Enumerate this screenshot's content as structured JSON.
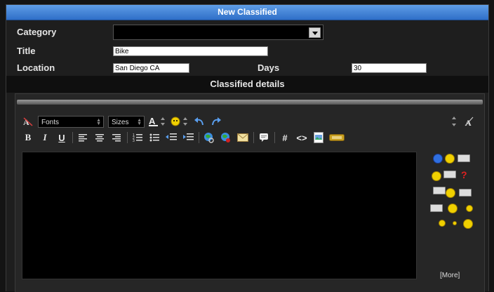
{
  "panel": {
    "title": "New Classified"
  },
  "form": {
    "category_label": "Category",
    "category_value": "",
    "title_label": "Title",
    "title_value": "Bike",
    "location_label": "Location",
    "location_value": "San Diego CA",
    "days_label": "Days",
    "days_value": "30"
  },
  "details": {
    "heading": "Classified details"
  },
  "editor": {
    "fonts_label": "Fonts",
    "sizes_label": "Sizes",
    "more_label": "[More]",
    "toolbar_row1": [
      "remove-format-icon",
      "font-color-icon",
      "smiley-icon",
      "undo-icon",
      "redo-icon",
      "resize-icon",
      "switch-mode-icon"
    ],
    "toolbar_row2": [
      "bold-icon",
      "italic-icon",
      "underline-icon",
      "align-left-icon",
      "align-center-icon",
      "align-right-icon",
      "ordered-list-icon",
      "unordered-list-icon",
      "outdent-icon",
      "indent-icon",
      "insert-link-icon",
      "remove-link-icon",
      "email-icon",
      "quote-icon",
      "hash-icon",
      "code-icon",
      "image-icon",
      "media-icon"
    ],
    "smilies_count": 17
  },
  "colors": {
    "header_blue": "#3a7ad3",
    "panel_bg": "#1e1e1e",
    "body_bg": "#141414"
  }
}
